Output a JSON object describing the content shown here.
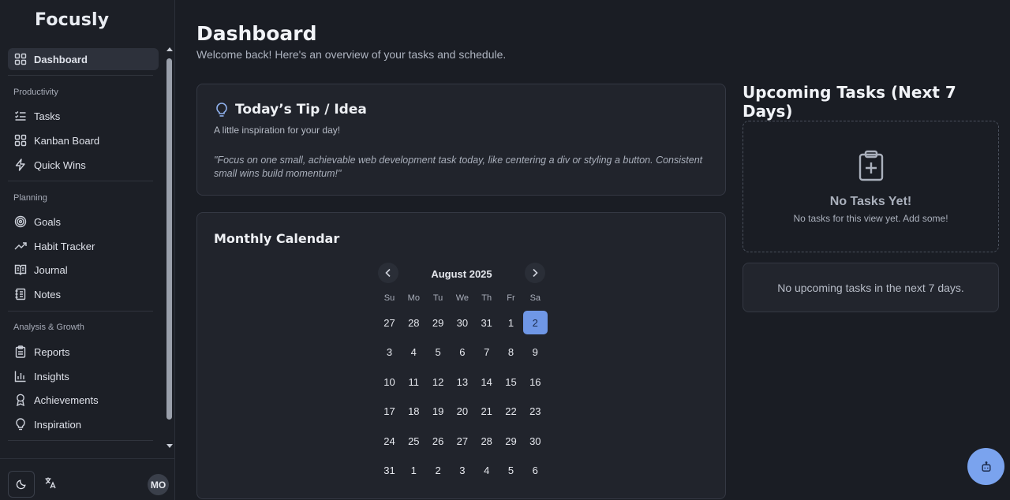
{
  "brand": "Focusly",
  "sidebar": {
    "dashboard": "Dashboard",
    "sections": {
      "productivity": "Productivity",
      "planning": "Planning",
      "analysis": "Analysis & Growth"
    },
    "items": {
      "tasks": "Tasks",
      "kanban": "Kanban Board",
      "quick_wins": "Quick Wins",
      "goals": "Goals",
      "habit_tracker": "Habit Tracker",
      "journal": "Journal",
      "notes": "Notes",
      "reports": "Reports",
      "insights": "Insights",
      "achievements": "Achievements",
      "inspiration": "Inspiration"
    },
    "avatar": "MO"
  },
  "header": {
    "title": "Dashboard",
    "subtitle": "Welcome back! Here's an overview of your tasks and schedule."
  },
  "tip": {
    "title": "Today’s Tip / Idea",
    "subtitle": "A little inspiration for your day!",
    "quote": "\"Focus on one small, achievable web development task today, like centering a div or styling a button. Consistent small wins build momentum!\""
  },
  "calendar": {
    "title": "Monthly Calendar",
    "month": "August 2025",
    "weekdays": [
      "Su",
      "Mo",
      "Tu",
      "We",
      "Th",
      "Fr",
      "Sa"
    ],
    "weeks": [
      [
        "27",
        "28",
        "29",
        "30",
        "31",
        "1",
        "2"
      ],
      [
        "3",
        "4",
        "5",
        "6",
        "7",
        "8",
        "9"
      ],
      [
        "10",
        "11",
        "12",
        "13",
        "14",
        "15",
        "16"
      ],
      [
        "17",
        "18",
        "19",
        "20",
        "21",
        "22",
        "23"
      ],
      [
        "24",
        "25",
        "26",
        "27",
        "28",
        "29",
        "30"
      ],
      [
        "31",
        "1",
        "2",
        "3",
        "4",
        "5",
        "6"
      ]
    ],
    "selected": "2"
  },
  "upcoming": {
    "title": "Upcoming Tasks (Next 7 Days)",
    "empty_title": "No Tasks Yet!",
    "empty_sub": "No tasks for this view yet. Add some!",
    "none_text": "No upcoming tasks in the next 7 days."
  }
}
